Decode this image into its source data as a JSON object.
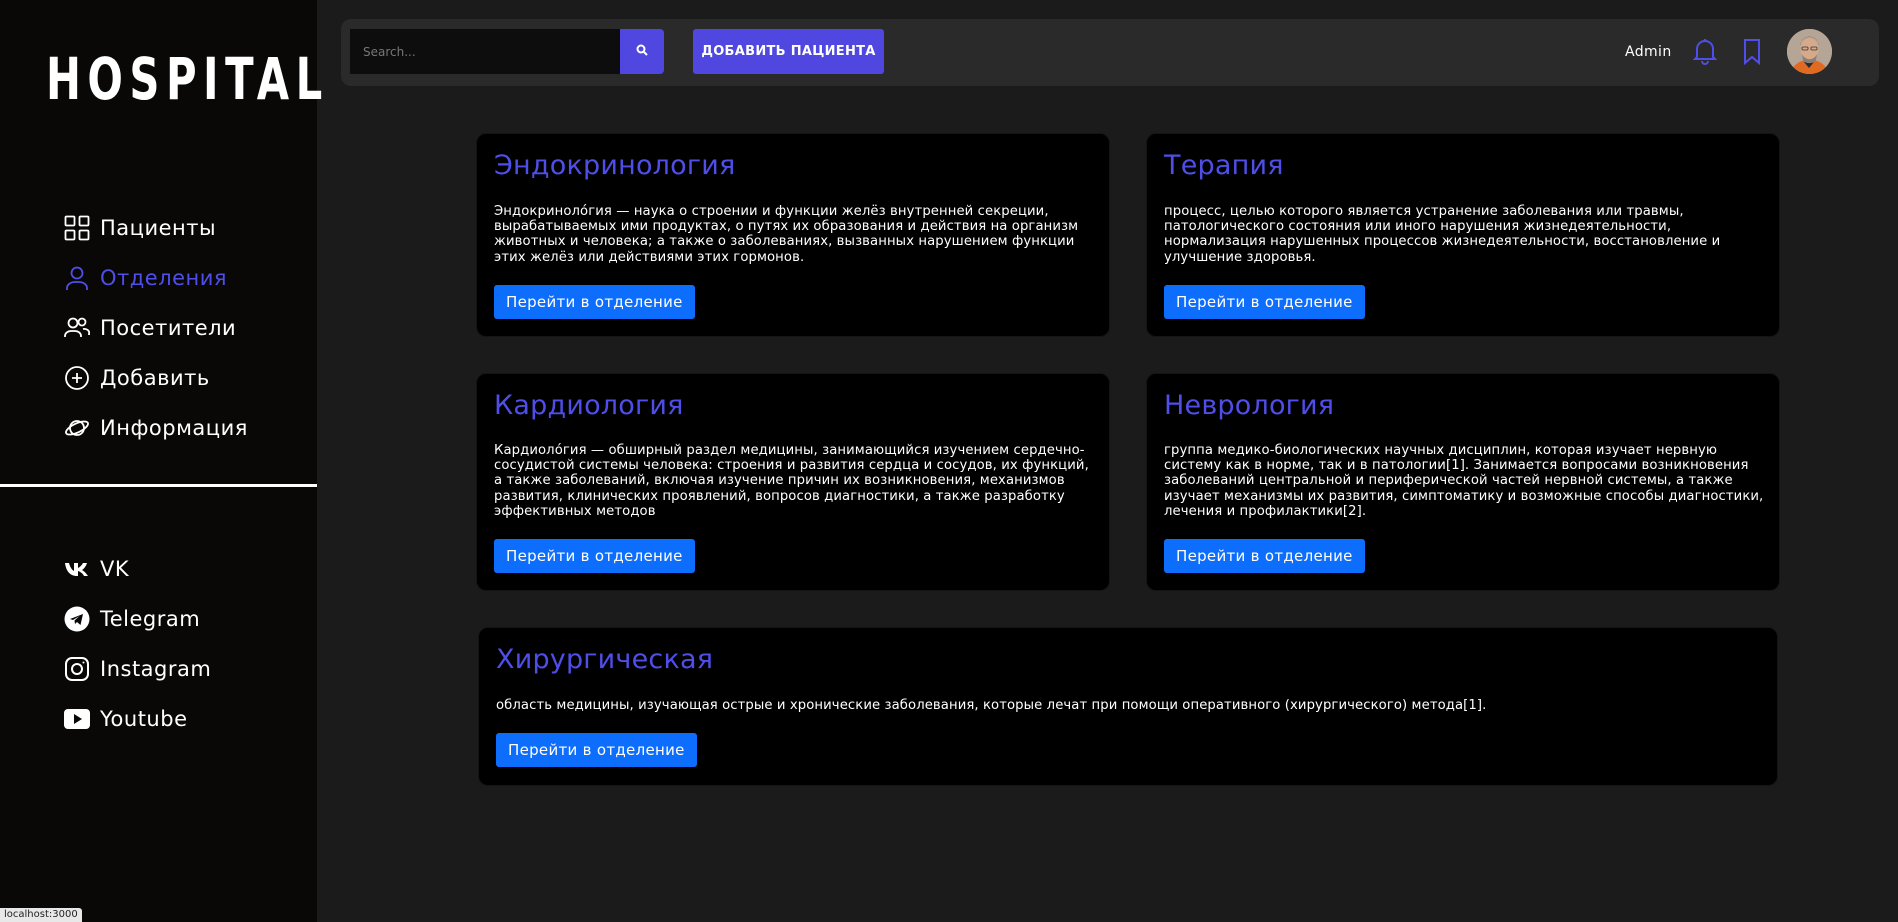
{
  "sidebar": {
    "logo": "HOSPITAL",
    "nav": [
      {
        "label": "Пациенты",
        "icon": "grid-icon"
      },
      {
        "label": "Отделения",
        "icon": "user-icon"
      },
      {
        "label": "Посетители",
        "icon": "users-icon"
      },
      {
        "label": "Добавить",
        "icon": "plus-circle-icon"
      },
      {
        "label": "Информация",
        "icon": "planet-icon"
      }
    ],
    "active_nav": "Отделения",
    "social": [
      {
        "label": "VK",
        "icon": "vk-icon"
      },
      {
        "label": "Telegram",
        "icon": "telegram-icon"
      },
      {
        "label": "Instagram",
        "icon": "instagram-icon"
      },
      {
        "label": "Youtube",
        "icon": "youtube-icon"
      }
    ]
  },
  "topbar": {
    "search_placeholder": "Search...",
    "add_patient_label": "ДОБАВИТЬ ПАЦИЕНТА",
    "user_name": "Admin"
  },
  "departments": [
    {
      "title": "Эндокринология",
      "description": "Эндокриноло́гия — наука о строении и функции желёз внутренней секреции, вырабатываемых ими продуктах, о путях их образования и действия на организм животных и человека; а также о заболеваниях, вызванных нарушением функции этих желёз или действиями этих гормонов.",
      "button": "Перейти в отделение"
    },
    {
      "title": "Терапия",
      "description": "процесс, целью которого является устранение заболевания или травмы, патологического состояния или иного нарушения жизнедеятельности, нормализация нарушенных процессов жизнедеятельности, восстановление и улучшение здоровья.",
      "button": "Перейти в отделение"
    },
    {
      "title": "Кардиология",
      "description": "Кардиоло́гия — обширный раздел медицины, занимающийся изучением сердечно-сосудистой системы человека: строения и развития сердца и сосудов, их функций, а также заболеваний, включая изучение причин их возникновения, механизмов развития, клинических проявлений, вопросов диагностики, а также разработку эффективных методов",
      "button": "Перейти в отделение"
    },
    {
      "title": "Неврология",
      "description": "группа медико-биологических научных дисциплин, которая изучает нервную систему как в норме, так и в патологии[1]. Занимается вопросами возникновения заболеваний центральной и периферической частей нервной системы, а также изучает механизмы их развития, симптоматику и возможные способы диагностики, лечения и профилактики[2].",
      "button": "Перейти в отделение"
    },
    {
      "title": "Хирургическая",
      "description": "область медицины, изучающая острые и хронические заболевания, которые лечат при помощи оперативного (хирургического) метода[1].",
      "button": "Перейти в отделение"
    }
  ],
  "status_bar": {
    "url": "localhost:3000"
  },
  "colors": {
    "accent": "#4f4ee8",
    "button": "#0d6efd",
    "sidebar_bg": "#090807",
    "page_bg": "#1b1b1b"
  }
}
